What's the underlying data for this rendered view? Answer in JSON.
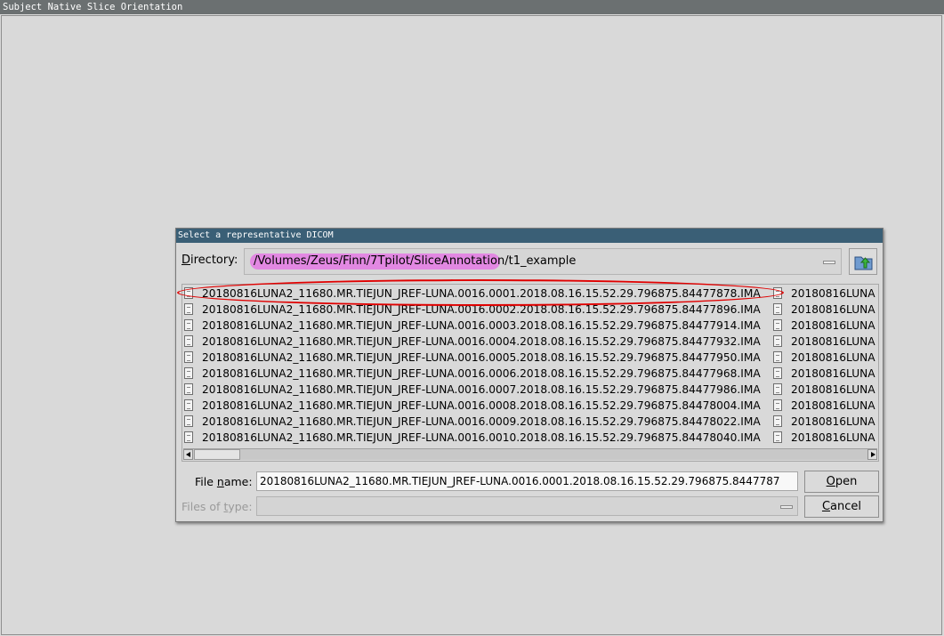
{
  "window": {
    "title": "Subject Native Slice Orientation"
  },
  "dialog": {
    "title": "Select a representative DICOM",
    "directory_label_prefix": "D",
    "directory_label_rest": "irectory:",
    "directory_path": "/Volumes/Zeus/Finn/7Tpilot/SliceAnnotation/t1_example",
    "file_list": {
      "column1": [
        "20180816LUNA2_11680.MR.TIEJUN_JREF-LUNA.0016.0001.2018.08.16.15.52.29.796875.84477878.IMA",
        "20180816LUNA2_11680.MR.TIEJUN_JREF-LUNA.0016.0002.2018.08.16.15.52.29.796875.84477896.IMA",
        "20180816LUNA2_11680.MR.TIEJUN_JREF-LUNA.0016.0003.2018.08.16.15.52.29.796875.84477914.IMA",
        "20180816LUNA2_11680.MR.TIEJUN_JREF-LUNA.0016.0004.2018.08.16.15.52.29.796875.84477932.IMA",
        "20180816LUNA2_11680.MR.TIEJUN_JREF-LUNA.0016.0005.2018.08.16.15.52.29.796875.84477950.IMA",
        "20180816LUNA2_11680.MR.TIEJUN_JREF-LUNA.0016.0006.2018.08.16.15.52.29.796875.84477968.IMA",
        "20180816LUNA2_11680.MR.TIEJUN_JREF-LUNA.0016.0007.2018.08.16.15.52.29.796875.84477986.IMA",
        "20180816LUNA2_11680.MR.TIEJUN_JREF-LUNA.0016.0008.2018.08.16.15.52.29.796875.84478004.IMA",
        "20180816LUNA2_11680.MR.TIEJUN_JREF-LUNA.0016.0009.2018.08.16.15.52.29.796875.84478022.IMA",
        "20180816LUNA2_11680.MR.TIEJUN_JREF-LUNA.0016.0010.2018.08.16.15.52.29.796875.84478040.IMA"
      ],
      "column2": [
        "20180816LUNA",
        "20180816LUNA",
        "20180816LUNA",
        "20180816LUNA",
        "20180816LUNA",
        "20180816LUNA",
        "20180816LUNA",
        "20180816LUNA",
        "20180816LUNA",
        "20180816LUNA"
      ]
    },
    "file_name_label_pre": "File ",
    "file_name_label_mn": "n",
    "file_name_label_post": "ame:",
    "file_name_value": "20180816LUNA2_11680.MR.TIEJUN_JREF-LUNA.0016.0001.2018.08.16.15.52.29.796875.8447787",
    "files_of_type_label_pre": "Files of ",
    "files_of_type_label_mn": "t",
    "files_of_type_label_post": "ype:",
    "files_of_type_value": "",
    "open_mn": "O",
    "open_rest": "pen",
    "cancel_mn": "C",
    "cancel_rest": "ancel",
    "icons": {
      "up_folder": "folder-up-icon",
      "file": "file-icon",
      "combo_arrow": "combo-dropdown-icon"
    },
    "colors": {
      "title_bar": "#3a5f76",
      "path_highlight": "#e288e2",
      "annotation": "#e00000"
    }
  }
}
